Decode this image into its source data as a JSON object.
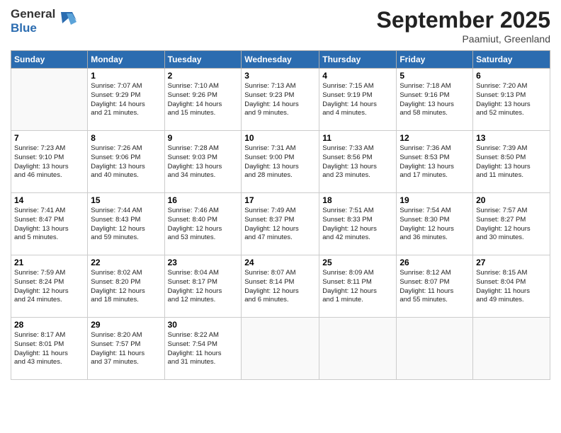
{
  "logo": {
    "line1": "General",
    "line2": "Blue"
  },
  "title": "September 2025",
  "location": "Paamiut, Greenland",
  "days_header": [
    "Sunday",
    "Monday",
    "Tuesday",
    "Wednesday",
    "Thursday",
    "Friday",
    "Saturday"
  ],
  "weeks": [
    [
      {
        "num": "",
        "info": ""
      },
      {
        "num": "1",
        "info": "Sunrise: 7:07 AM\nSunset: 9:29 PM\nDaylight: 14 hours\nand 21 minutes."
      },
      {
        "num": "2",
        "info": "Sunrise: 7:10 AM\nSunset: 9:26 PM\nDaylight: 14 hours\nand 15 minutes."
      },
      {
        "num": "3",
        "info": "Sunrise: 7:13 AM\nSunset: 9:23 PM\nDaylight: 14 hours\nand 9 minutes."
      },
      {
        "num": "4",
        "info": "Sunrise: 7:15 AM\nSunset: 9:19 PM\nDaylight: 14 hours\nand 4 minutes."
      },
      {
        "num": "5",
        "info": "Sunrise: 7:18 AM\nSunset: 9:16 PM\nDaylight: 13 hours\nand 58 minutes."
      },
      {
        "num": "6",
        "info": "Sunrise: 7:20 AM\nSunset: 9:13 PM\nDaylight: 13 hours\nand 52 minutes."
      }
    ],
    [
      {
        "num": "7",
        "info": "Sunrise: 7:23 AM\nSunset: 9:10 PM\nDaylight: 13 hours\nand 46 minutes."
      },
      {
        "num": "8",
        "info": "Sunrise: 7:26 AM\nSunset: 9:06 PM\nDaylight: 13 hours\nand 40 minutes."
      },
      {
        "num": "9",
        "info": "Sunrise: 7:28 AM\nSunset: 9:03 PM\nDaylight: 13 hours\nand 34 minutes."
      },
      {
        "num": "10",
        "info": "Sunrise: 7:31 AM\nSunset: 9:00 PM\nDaylight: 13 hours\nand 28 minutes."
      },
      {
        "num": "11",
        "info": "Sunrise: 7:33 AM\nSunset: 8:56 PM\nDaylight: 13 hours\nand 23 minutes."
      },
      {
        "num": "12",
        "info": "Sunrise: 7:36 AM\nSunset: 8:53 PM\nDaylight: 13 hours\nand 17 minutes."
      },
      {
        "num": "13",
        "info": "Sunrise: 7:39 AM\nSunset: 8:50 PM\nDaylight: 13 hours\nand 11 minutes."
      }
    ],
    [
      {
        "num": "14",
        "info": "Sunrise: 7:41 AM\nSunset: 8:47 PM\nDaylight: 13 hours\nand 5 minutes."
      },
      {
        "num": "15",
        "info": "Sunrise: 7:44 AM\nSunset: 8:43 PM\nDaylight: 12 hours\nand 59 minutes."
      },
      {
        "num": "16",
        "info": "Sunrise: 7:46 AM\nSunset: 8:40 PM\nDaylight: 12 hours\nand 53 minutes."
      },
      {
        "num": "17",
        "info": "Sunrise: 7:49 AM\nSunset: 8:37 PM\nDaylight: 12 hours\nand 47 minutes."
      },
      {
        "num": "18",
        "info": "Sunrise: 7:51 AM\nSunset: 8:33 PM\nDaylight: 12 hours\nand 42 minutes."
      },
      {
        "num": "19",
        "info": "Sunrise: 7:54 AM\nSunset: 8:30 PM\nDaylight: 12 hours\nand 36 minutes."
      },
      {
        "num": "20",
        "info": "Sunrise: 7:57 AM\nSunset: 8:27 PM\nDaylight: 12 hours\nand 30 minutes."
      }
    ],
    [
      {
        "num": "21",
        "info": "Sunrise: 7:59 AM\nSunset: 8:24 PM\nDaylight: 12 hours\nand 24 minutes."
      },
      {
        "num": "22",
        "info": "Sunrise: 8:02 AM\nSunset: 8:20 PM\nDaylight: 12 hours\nand 18 minutes."
      },
      {
        "num": "23",
        "info": "Sunrise: 8:04 AM\nSunset: 8:17 PM\nDaylight: 12 hours\nand 12 minutes."
      },
      {
        "num": "24",
        "info": "Sunrise: 8:07 AM\nSunset: 8:14 PM\nDaylight: 12 hours\nand 6 minutes."
      },
      {
        "num": "25",
        "info": "Sunrise: 8:09 AM\nSunset: 8:11 PM\nDaylight: 12 hours\nand 1 minute."
      },
      {
        "num": "26",
        "info": "Sunrise: 8:12 AM\nSunset: 8:07 PM\nDaylight: 11 hours\nand 55 minutes."
      },
      {
        "num": "27",
        "info": "Sunrise: 8:15 AM\nSunset: 8:04 PM\nDaylight: 11 hours\nand 49 minutes."
      }
    ],
    [
      {
        "num": "28",
        "info": "Sunrise: 8:17 AM\nSunset: 8:01 PM\nDaylight: 11 hours\nand 43 minutes."
      },
      {
        "num": "29",
        "info": "Sunrise: 8:20 AM\nSunset: 7:57 PM\nDaylight: 11 hours\nand 37 minutes."
      },
      {
        "num": "30",
        "info": "Sunrise: 8:22 AM\nSunset: 7:54 PM\nDaylight: 11 hours\nand 31 minutes."
      },
      {
        "num": "",
        "info": ""
      },
      {
        "num": "",
        "info": ""
      },
      {
        "num": "",
        "info": ""
      },
      {
        "num": "",
        "info": ""
      }
    ]
  ]
}
